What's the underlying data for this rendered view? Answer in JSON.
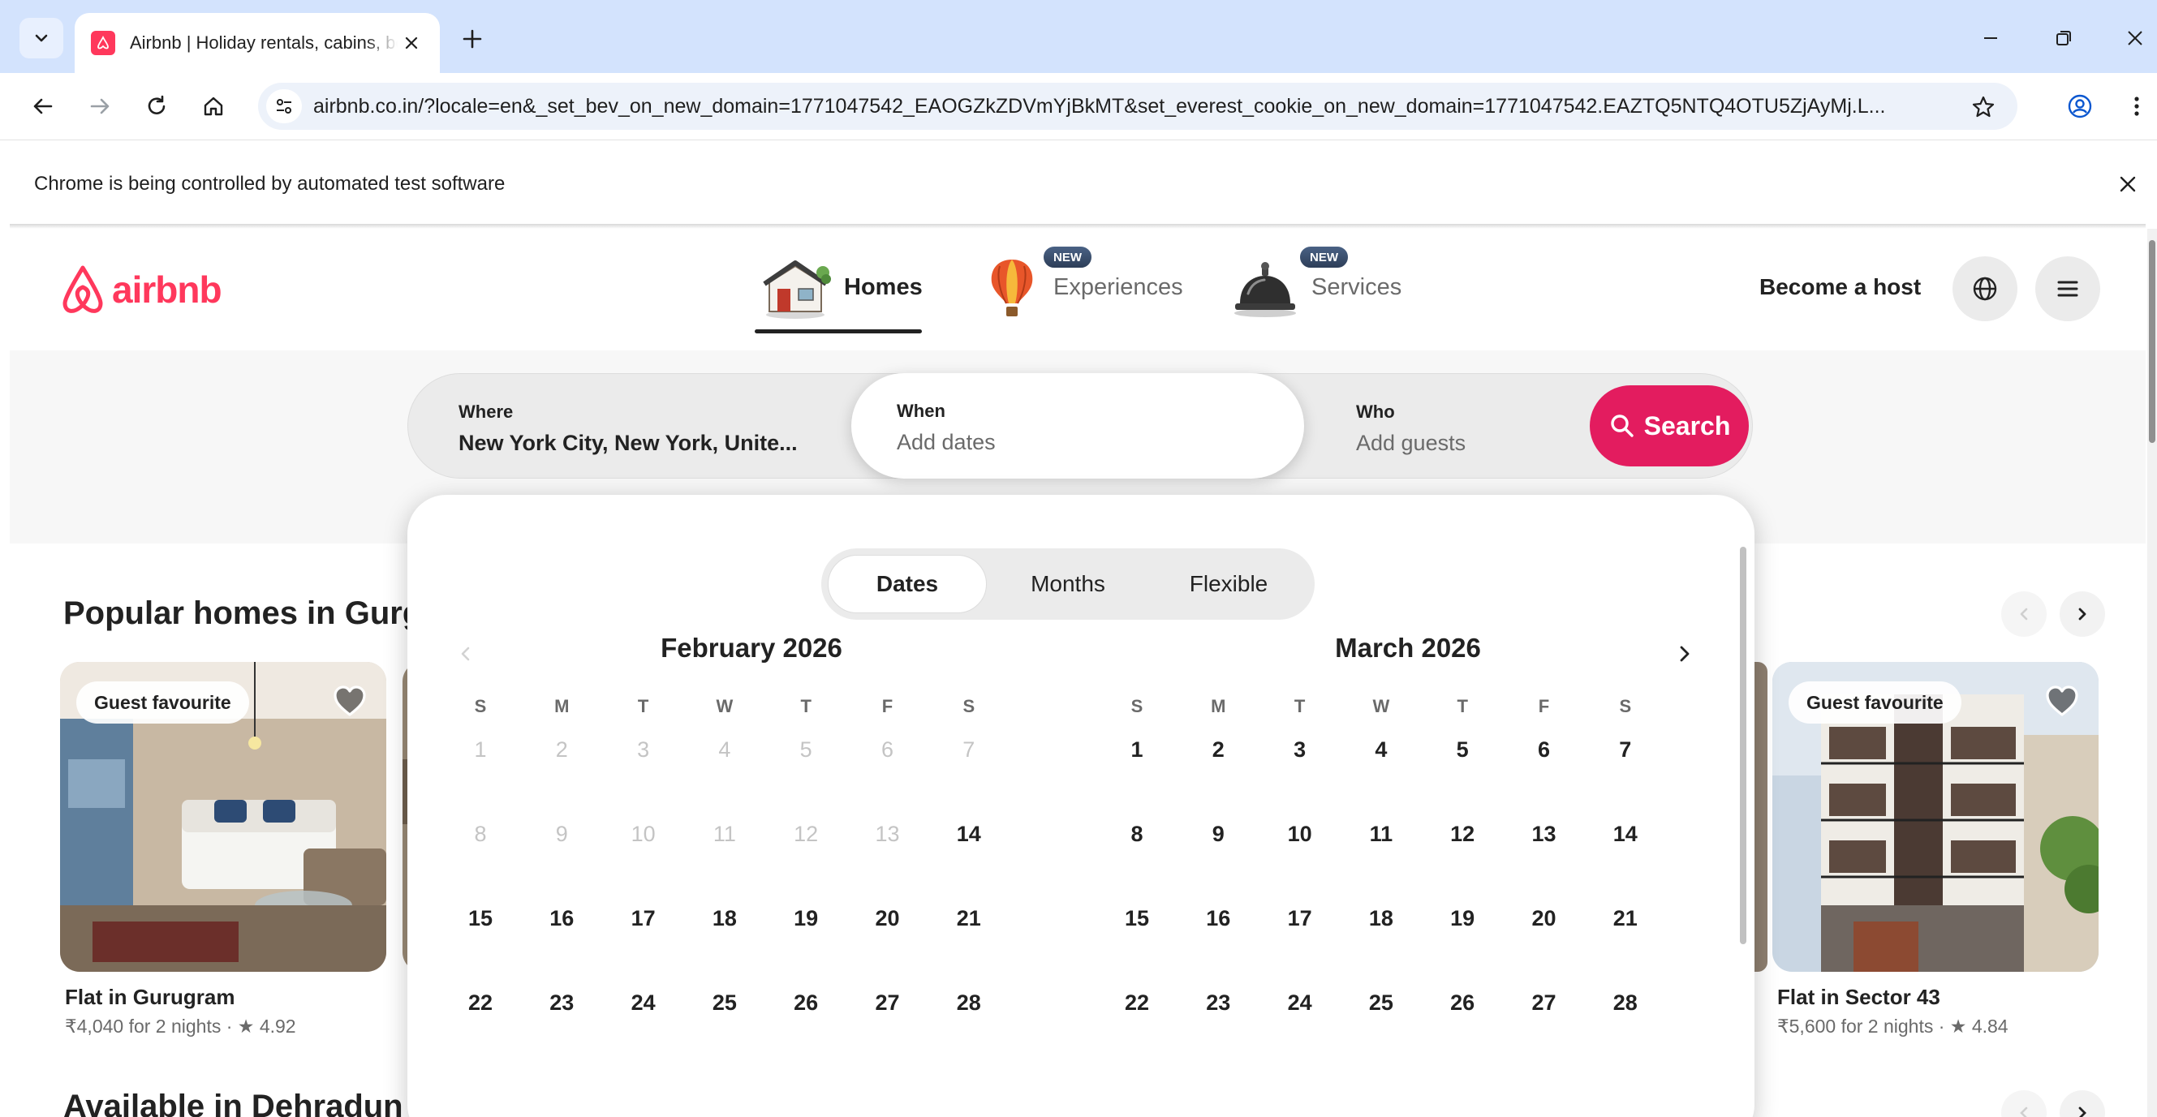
{
  "browser": {
    "tab_title": "Airbnb | Holiday rentals, cabins, beach houses & more",
    "url": "airbnb.co.in/?locale=en&_set_bev_on_new_domain=1771047542_EAOGZkZDVmYjBkMT&set_everest_cookie_on_new_domain=1771047542.EAZTQ5NTQ4OTU5ZjAyMj.L...",
    "infobar_text": "Chrome is being controlled by automated test software"
  },
  "header": {
    "logo_text": "airbnb",
    "nav": [
      {
        "label": "Homes",
        "active": true
      },
      {
        "label": "Experiences",
        "badge": "NEW"
      },
      {
        "label": "Services",
        "badge": "NEW"
      }
    ],
    "become_host": "Become a host"
  },
  "search": {
    "where_label": "Where",
    "where_value": "New York City, New York, Unite...",
    "when_label": "When",
    "when_placeholder": "Add dates",
    "who_label": "Who",
    "who_placeholder": "Add guests",
    "button_label": "Search"
  },
  "listings": {
    "section_title": "Popular homes in Gurgaon",
    "section_title_2": "Available in Dehradun this weekend",
    "cards": [
      {
        "badge": "Guest favourite",
        "title": "Flat in Gurugram",
        "meta": "₹4,040 for 2 nights · ★ 4.92"
      },
      {
        "badge": "Guest favourite",
        "title": "Flat in Sector 43",
        "meta": "₹5,600 for 2 nights · ★ 4.84"
      }
    ]
  },
  "picker": {
    "modes": [
      "Dates",
      "Months",
      "Flexible"
    ],
    "active_mode": "Dates",
    "weekdays": [
      "S",
      "M",
      "T",
      "W",
      "T",
      "F",
      "S"
    ],
    "months": [
      {
        "title": "February 2026",
        "start_weekday": 0,
        "days_shown": 28,
        "first_available": 14
      },
      {
        "title": "March 2026",
        "start_weekday": 0,
        "days_shown": 28,
        "first_available": 1
      }
    ]
  },
  "colors": {
    "brand": "#ff385c",
    "search_button": "#e31c5f",
    "chrome_tabstrip": "#d3e3fd"
  }
}
